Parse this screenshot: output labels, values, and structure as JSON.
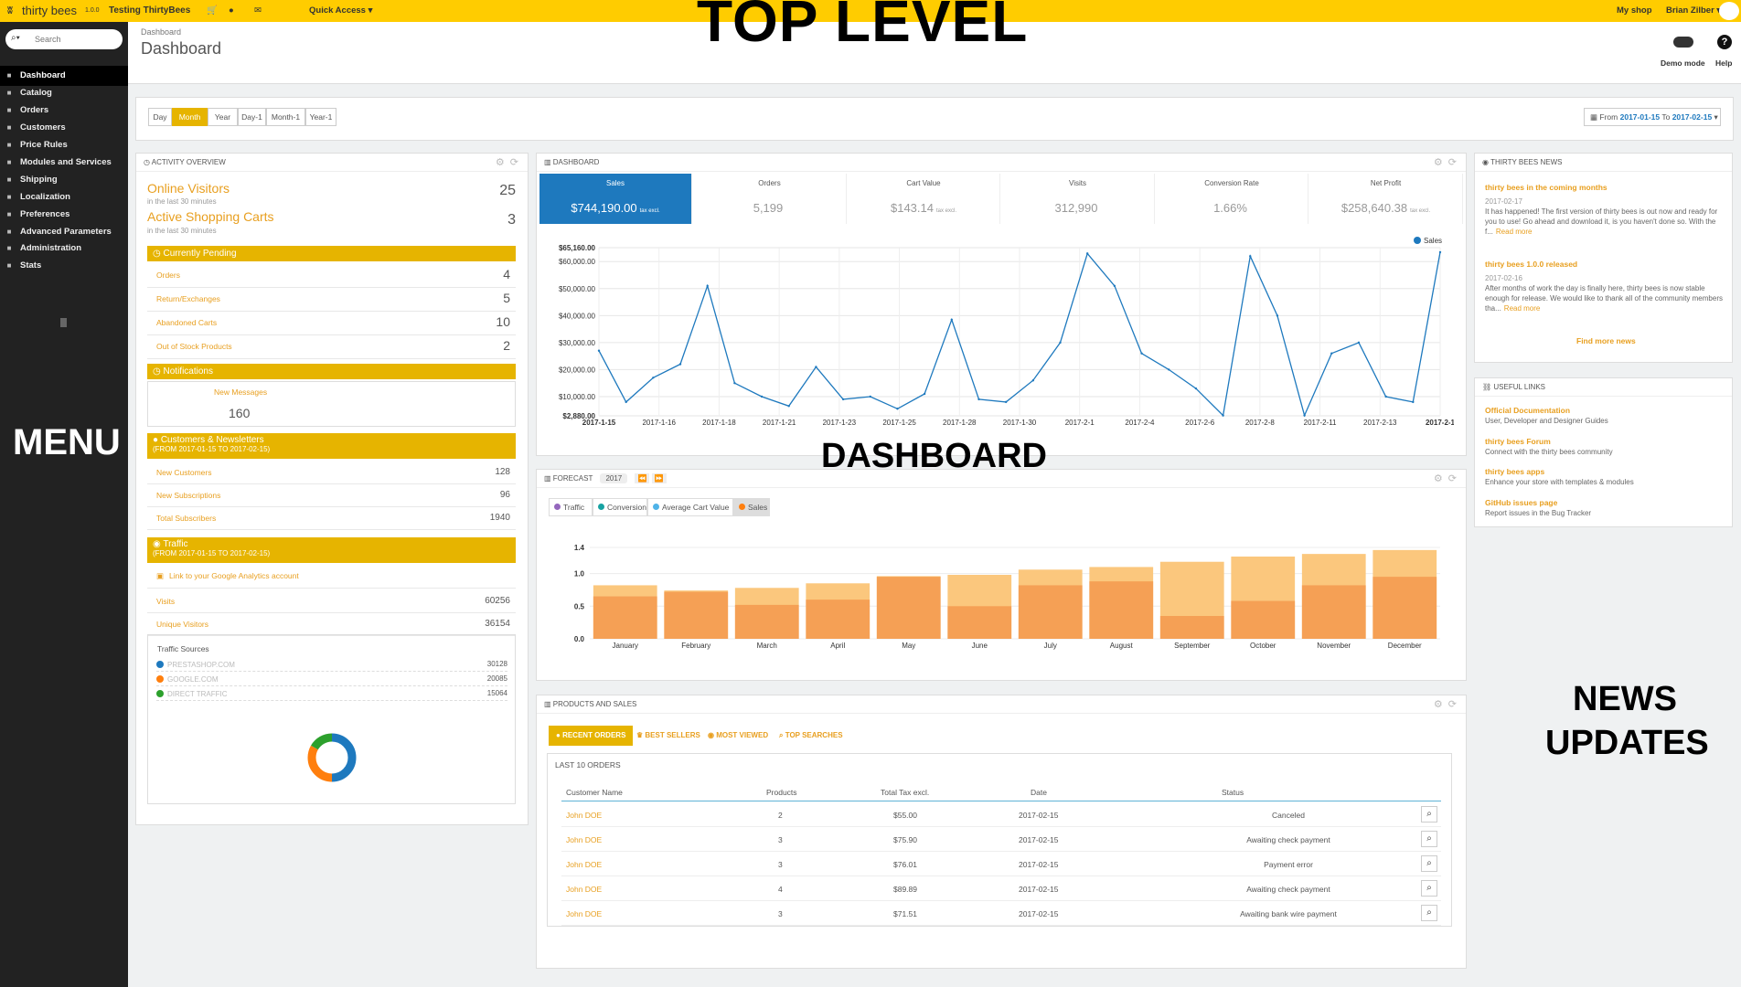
{
  "topbar": {
    "logo": "thirty bees",
    "version": "1.0.0",
    "shop_name": "Testing ThirtyBees",
    "quick_access": "Quick Access ▾",
    "my_shop": "My shop",
    "user": "Brian Zilber ▾"
  },
  "search": {
    "placeholder": "Search"
  },
  "sidebar": {
    "items": [
      {
        "label": "Dashboard",
        "icon": "dashboard-icon"
      },
      {
        "label": "Catalog",
        "icon": "catalog-icon"
      },
      {
        "label": "Orders",
        "icon": "orders-icon"
      },
      {
        "label": "Customers",
        "icon": "customers-icon"
      },
      {
        "label": "Price Rules",
        "icon": "price-rules-icon"
      },
      {
        "label": "Modules and Services",
        "icon": "modules-icon"
      },
      {
        "label": "Shipping",
        "icon": "shipping-icon"
      },
      {
        "label": "Localization",
        "icon": "localization-icon"
      },
      {
        "label": "Preferences",
        "icon": "preferences-icon"
      },
      {
        "label": "Advanced Parameters",
        "icon": "advanced-icon"
      },
      {
        "label": "Administration",
        "icon": "administration-icon"
      },
      {
        "label": "Stats",
        "icon": "stats-icon"
      }
    ]
  },
  "header": {
    "breadcrumb": "Dashboard",
    "title": "Dashboard",
    "demo_mode": "Demo mode",
    "help": "Help"
  },
  "period": {
    "buttons": [
      "Day",
      "Month",
      "Year",
      "Day-1",
      "Month-1",
      "Year-1"
    ],
    "active": "Month",
    "range_prefix": "From",
    "range_from": "2017-01-15",
    "range_to_word": "To",
    "range_to": "2017-02-15"
  },
  "activity": {
    "title": "Activity overview",
    "online_visitors": {
      "label": "Online Visitors",
      "sub": "in the last 30 minutes",
      "value": "25"
    },
    "active_carts": {
      "label": "Active Shopping Carts",
      "sub": "in the last 30 minutes",
      "value": "3"
    },
    "pending_title": "Currently Pending",
    "pending": [
      {
        "label": "Orders",
        "value": "4"
      },
      {
        "label": "Return/Exchanges",
        "value": "5"
      },
      {
        "label": "Abandoned Carts",
        "value": "10"
      },
      {
        "label": "Out of Stock Products",
        "value": "2"
      }
    ],
    "notifications_title": "Notifications",
    "new_messages_label": "New Messages",
    "new_messages_value": "160",
    "customers_title": "Customers & Newsletters",
    "customers_range": "(FROM 2017-01-15 TO 2017-02-15)",
    "customers": [
      {
        "label": "New Customers",
        "value": "128"
      },
      {
        "label": "New Subscriptions",
        "value": "96"
      },
      {
        "label": "Total Subscribers",
        "value": "1940"
      }
    ],
    "traffic_title": "Traffic",
    "traffic_range": "(FROM 2017-01-15 TO 2017-02-15)",
    "ga_link": "Link to your Google Analytics account",
    "traffic": [
      {
        "label": "Visits",
        "value": "60256"
      },
      {
        "label": "Unique Visitors",
        "value": "36154"
      }
    ],
    "sources_title": "Traffic Sources",
    "sources": [
      {
        "label": "PRESTASHOP.COM",
        "value": "30128",
        "color": "#1e79be"
      },
      {
        "label": "GOOGLE.COM",
        "value": "20085",
        "color": "#ff7f0e"
      },
      {
        "label": "DIRECT TRAFFIC",
        "value": "15064",
        "color": "#2ca02c"
      }
    ]
  },
  "dashboard": {
    "title": "Dashboard",
    "kpis": [
      {
        "name": "Sales",
        "value": "$744,190.00",
        "suffix": "tax excl."
      },
      {
        "name": "Orders",
        "value": "5,199",
        "suffix": ""
      },
      {
        "name": "Cart Value",
        "value": "$143.14",
        "suffix": "tax excl."
      },
      {
        "name": "Visits",
        "value": "312,990",
        "suffix": ""
      },
      {
        "name": "Conversion Rate",
        "value": "1.66%",
        "suffix": ""
      },
      {
        "name": "Net Profit",
        "value": "$258,640.38",
        "suffix": "tax excl."
      }
    ],
    "legend": "Sales"
  },
  "forecast": {
    "title": "Forecast",
    "year": "2017",
    "tabs": [
      {
        "label": "Traffic",
        "color": "#9467bd"
      },
      {
        "label": "Conversion",
        "color": "#17a2a2"
      },
      {
        "label": "Average Cart Value",
        "color": "#4fb3e8"
      },
      {
        "label": "Sales",
        "color": "#ff7f0e"
      }
    ]
  },
  "products": {
    "title": "Products and Sales",
    "tabs": [
      "RECENT ORDERS",
      "BEST SELLERS",
      "MOST VIEWED",
      "TOP SEARCHES"
    ],
    "subtitle": "LAST 10 ORDERS",
    "columns": [
      "Customer Name",
      "Products",
      "Total Tax excl.",
      "Date",
      "Status"
    ],
    "rows": [
      {
        "name": "John DOE",
        "products": "2",
        "total": "$55.00",
        "date": "2017-02-15",
        "status": "Canceled"
      },
      {
        "name": "John DOE",
        "products": "3",
        "total": "$75.90",
        "date": "2017-02-15",
        "status": "Awaiting check payment"
      },
      {
        "name": "John DOE",
        "products": "3",
        "total": "$76.01",
        "date": "2017-02-15",
        "status": "Payment error"
      },
      {
        "name": "John DOE",
        "products": "4",
        "total": "$89.89",
        "date": "2017-02-15",
        "status": "Awaiting check payment"
      },
      {
        "name": "John DOE",
        "products": "3",
        "total": "$71.51",
        "date": "2017-02-15",
        "status": "Awaiting bank wire payment"
      }
    ]
  },
  "news": {
    "title": "Thirty Bees News",
    "items": [
      {
        "title": "thirty bees in the coming months",
        "date": "2017-02-17",
        "text": "It has happened! The first version of thirty bees is out now and ready for you to use! Go ahead and download it, is you haven't done so. With the f...",
        "more": "Read more"
      },
      {
        "title": "thirty bees 1.0.0 released",
        "date": "2017-02-16",
        "text": "After months of work the day is finally here, thirty bees is now stable enough for release. We would like to thank all of the community members tha...",
        "more": "Read more"
      }
    ],
    "find_more": "Find more news"
  },
  "links": {
    "title": "Useful Links",
    "items": [
      {
        "title": "Official Documentation",
        "desc": "User, Developer and Designer Guides"
      },
      {
        "title": "thirty bees Forum",
        "desc": "Connect with the thirty bees community"
      },
      {
        "title": "thirty bees apps",
        "desc": "Enhance your store with templates & modules"
      },
      {
        "title": "GitHub issues page",
        "desc": "Report issues in the Bug Tracker"
      }
    ]
  },
  "overlays": {
    "top": "TOP LEVEL",
    "menu": "MENU",
    "dashboard": "DASHBOARD",
    "news1": "NEWS",
    "news2": "UPDATES"
  },
  "chart_data": [
    {
      "type": "line",
      "legend": "Sales",
      "ylim": [
        2880,
        65160
      ],
      "y_ticks": [
        "$2,880.00",
        "$10,000.00",
        "$20,000.00",
        "$30,000.00",
        "$40,000.00",
        "$50,000.00",
        "$60,000.00",
        "$65,160.00"
      ],
      "x_ticks": [
        "2017-1-15",
        "2017-1-16",
        "2017-1-18",
        "2017-1-21",
        "2017-1-23",
        "2017-1-25",
        "2017-1-28",
        "2017-1-30",
        "2017-2-1",
        "2017-2-4",
        "2017-2-6",
        "2017-2-8",
        "2017-2-11",
        "2017-2-13",
        "2017-2-1"
      ],
      "values": [
        27000,
        8000,
        17000,
        22000,
        51000,
        15000,
        10000,
        6500,
        21000,
        9000,
        10000,
        5500,
        11000,
        38500,
        9000,
        8000,
        16000,
        30000,
        63000,
        51000,
        26000,
        20000,
        13000,
        3000,
        62000,
        40000,
        3000,
        26000,
        30000,
        10000,
        8000,
        63500
      ],
      "color": "#1e79be"
    },
    {
      "type": "bar",
      "categories": [
        "January",
        "February",
        "March",
        "April",
        "May",
        "June",
        "July",
        "August",
        "September",
        "October",
        "November",
        "December"
      ],
      "y_ticks": [
        "0.0",
        "0.5",
        "1.0",
        "1.4"
      ],
      "ylim": [
        0,
        1.4
      ],
      "series": [
        {
          "name": "Sales",
          "values": [
            0.65,
            0.72,
            0.52,
            0.6,
            0.95,
            0.5,
            0.82,
            0.88,
            0.35,
            0.58,
            0.82,
            0.95
          ]
        },
        {
          "name": "Sales",
          "values": [
            0.82,
            0.74,
            0.78,
            0.85,
            0.96,
            0.98,
            1.06,
            1.1,
            1.18,
            1.26,
            1.3,
            1.36
          ]
        }
      ],
      "colors": [
        "#f5a055",
        "#fbc77d"
      ]
    }
  ]
}
